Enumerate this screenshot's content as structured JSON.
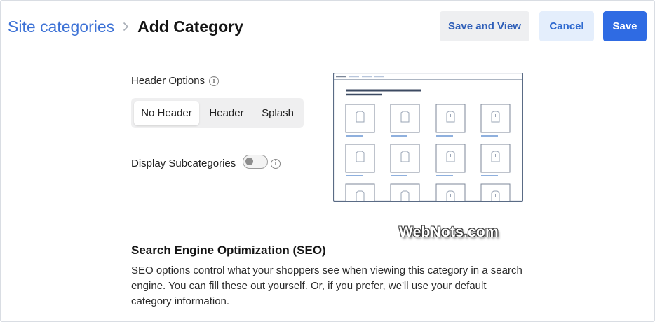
{
  "breadcrumb": {
    "parent": "Site categories",
    "current": "Add Category"
  },
  "actions": {
    "save_and_view": "Save and View",
    "cancel": "Cancel",
    "save": "Save"
  },
  "header_options": {
    "label": "Header Options",
    "options": [
      "No Header",
      "Header",
      "Splash"
    ],
    "selected": "No Header"
  },
  "display_subcategories": {
    "label": "Display Subcategories",
    "enabled": false
  },
  "watermark": "WebNots.com",
  "seo": {
    "title": "Search Engine Optimization (SEO)",
    "description": "SEO options control what your shoppers see when viewing this category in a search engine. You can fill these out yourself. Or, if you prefer, we'll use your default category information."
  },
  "colors": {
    "primary": "#2f6be3",
    "link": "#3d72d6",
    "preview_stroke": "#5a6b85"
  }
}
